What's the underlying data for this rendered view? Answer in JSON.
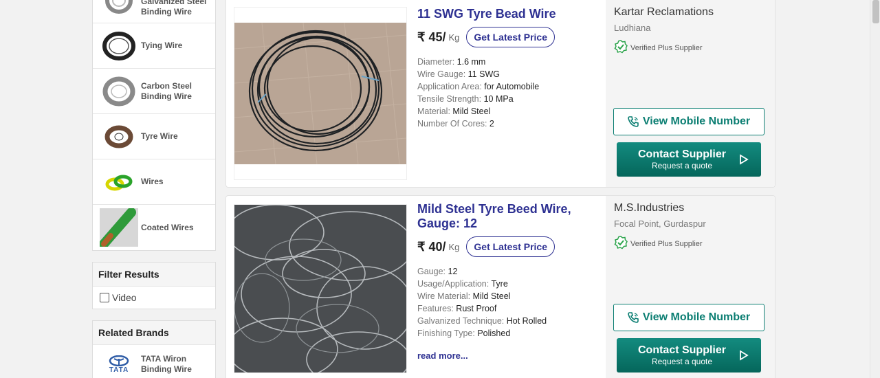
{
  "sidebar": {
    "categories": [
      {
        "label": "Galvanized Steel Binding Wire",
        "icon": "wire-coil-icon"
      },
      {
        "label": "Tying Wire",
        "icon": "wire-coil-icon"
      },
      {
        "label": "Carbon Steel Binding Wire",
        "icon": "wire-coil-icon"
      },
      {
        "label": "Tyre Wire",
        "icon": "wire-coil-icon"
      },
      {
        "label": "Wires",
        "icon": "wire-bundle-icon"
      },
      {
        "label": "Coated Wires",
        "icon": "coated-wire-icon"
      }
    ],
    "filter": {
      "title": "Filter Results",
      "video_label": "Video"
    },
    "brands": {
      "title": "Related Brands",
      "items": [
        {
          "label": "TATA Wiron Binding Wire",
          "logo_text": "TATA"
        }
      ]
    }
  },
  "products": [
    {
      "title": "11 SWG Tyre Bead Wire",
      "price": "₹ 45/",
      "unit": "Kg",
      "price_button": "Get Latest Price",
      "specs": [
        {
          "k": "Diameter:",
          "v": "1.6 mm"
        },
        {
          "k": "Wire Gauge:",
          "v": "11 SWG"
        },
        {
          "k": "Application Area:",
          "v": "for Automobile"
        },
        {
          "k": "Tensile Strength:",
          "v": "10 MPa"
        },
        {
          "k": "Material:",
          "v": "Mild Steel"
        },
        {
          "k": "Number Of Cores:",
          "v": "2"
        }
      ],
      "seller": {
        "name": "Kartar Reclamations",
        "location": "Ludhiana",
        "badge": "Verified Plus Supplier"
      },
      "mobile_button": "View Mobile Number",
      "contact_button": "Contact Supplier",
      "contact_sub": "Request a quote"
    },
    {
      "title": "Mild Steel Tyre Beed Wire, Gauge: 12",
      "price": "₹ 40/",
      "unit": "Kg",
      "price_button": "Get Latest Price",
      "specs": [
        {
          "k": "Gauge:",
          "v": "12"
        },
        {
          "k": "Usage/Application:",
          "v": "Tyre"
        },
        {
          "k": "Wire Material:",
          "v": "Mild Steel"
        },
        {
          "k": "Features:",
          "v": "Rust Proof"
        },
        {
          "k": "Galvanized Technique:",
          "v": "Hot Rolled"
        },
        {
          "k": "Finishing Type:",
          "v": "Polished"
        }
      ],
      "read_more": "read more...",
      "seller": {
        "name": "M.S.Industries",
        "location": "Focal Point, Gurdaspur",
        "badge": "Verified Plus Supplier"
      },
      "mobile_button": "View Mobile Number",
      "contact_button": "Contact Supplier",
      "contact_sub": "Request a quote"
    }
  ],
  "colors": {
    "title": "#2e3192",
    "accent": "#0b7e72",
    "verified": "#2aa34a"
  }
}
